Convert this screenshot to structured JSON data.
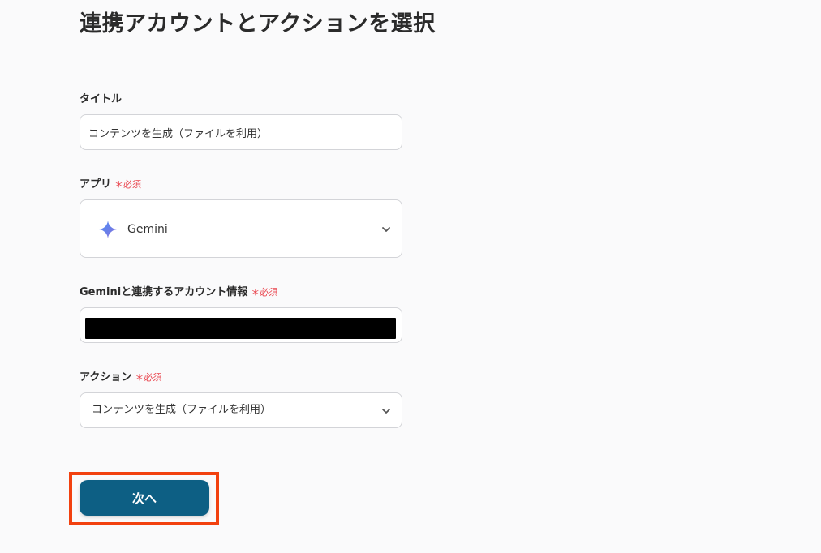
{
  "page": {
    "title": "連携アカウントとアクションを選択"
  },
  "colors": {
    "required": "#e9434c",
    "primary_button": "#0d5f84",
    "highlight_border": "#f2410f"
  },
  "title_field": {
    "label": "タイトル",
    "value": "コンテンツを生成（ファイルを利用）"
  },
  "app_field": {
    "label": "アプリ",
    "required_mark": "＊必須",
    "icon": "gemini-sparkle-icon",
    "selected": "Gemini"
  },
  "account_field": {
    "label": "Geminiと連携するアカウント情報",
    "required_mark": "＊必須"
  },
  "action_field": {
    "label": "アクション",
    "required_mark": "＊必須",
    "selected": "コンテンツを生成（ファイルを利用）"
  },
  "next_button": {
    "label": "次へ"
  }
}
